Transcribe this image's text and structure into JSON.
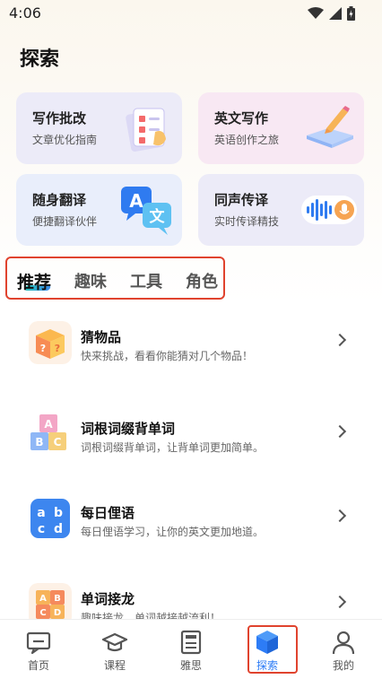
{
  "status_bar": {
    "time": "4:06"
  },
  "page": {
    "title": "探索"
  },
  "cards": [
    {
      "title": "写作批改",
      "subtitle": "文章优化指南",
      "icon": "clipboard-check-icon"
    },
    {
      "title": "英文写作",
      "subtitle": "英语创作之旅",
      "icon": "notebook-pen-icon"
    },
    {
      "title": "随身翻译",
      "subtitle": "便捷翻译伙伴",
      "icon": "translate-bubbles-icon"
    },
    {
      "title": "同声传译",
      "subtitle": "实时传译精技",
      "icon": "voice-wave-mic-icon"
    }
  ],
  "tabs": [
    {
      "label": "推荐",
      "active": true
    },
    {
      "label": "趣味",
      "active": false
    },
    {
      "label": "工具",
      "active": false
    },
    {
      "label": "角色",
      "active": false
    }
  ],
  "list": [
    {
      "title": "猜物品",
      "desc": "快来挑战，看看你能猜对几个物品！",
      "icon": "mystery-box-icon"
    },
    {
      "title": "词根词缀背单词",
      "desc": "词根词缀背单词，让背单词更加简单。",
      "icon": "abc-blocks-icon"
    },
    {
      "title": "每日俚语",
      "desc": "每日俚语学习，让你的英文更加地道。",
      "icon": "abcd-tile-icon"
    },
    {
      "title": "单词接龙",
      "desc": "趣味接龙，单词越接越流利！",
      "icon": "letter-blocks-icon"
    }
  ],
  "bottom_nav": [
    {
      "label": "首页",
      "icon": "home-chat-icon",
      "active": false
    },
    {
      "label": "课程",
      "icon": "graduation-cap-icon",
      "active": false
    },
    {
      "label": "雅思",
      "icon": "ielts-book-icon",
      "active": false
    },
    {
      "label": "探索",
      "icon": "cube-icon",
      "active": true
    },
    {
      "label": "我的",
      "icon": "user-icon",
      "active": false
    }
  ],
  "colors": {
    "accent": "#2d7cf6",
    "highlight_border": "#e0432e"
  }
}
